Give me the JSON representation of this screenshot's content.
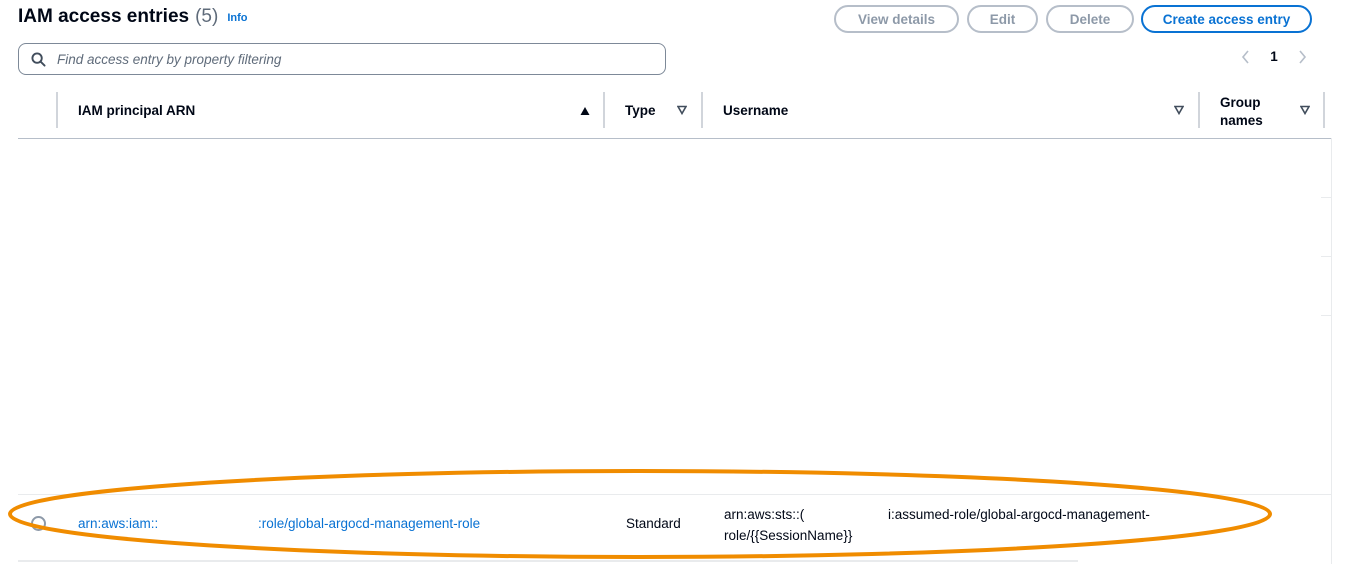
{
  "header": {
    "title": "IAM access entries",
    "count": "(5)",
    "info_label": "Info"
  },
  "actions": {
    "view_details": "View details",
    "edit": "Edit",
    "delete": "Delete",
    "create": "Create access entry"
  },
  "search": {
    "placeholder": "Find access entry by property filtering",
    "value": "",
    "icon": "search-icon"
  },
  "pagination": {
    "current_page": "1",
    "prev_icon": "chevron-left-icon",
    "next_icon": "chevron-right-icon"
  },
  "table": {
    "columns": [
      {
        "label": "IAM principal ARN",
        "sort": "ascending"
      },
      {
        "label": "Type",
        "sort": "none"
      },
      {
        "label": "Username",
        "sort": "none"
      },
      {
        "label": "Group names",
        "sort": "none"
      }
    ],
    "rows": [
      {
        "arn_prefix": "arn:aws:iam::",
        "arn_suffix": ":role/global-argocd-management-role",
        "type": "Standard",
        "username_line1_prefix": "arn:aws:sts::(",
        "username_line1_suffix": "i:assumed-role/global-argocd-management-",
        "username_line2": "role/{{SessionName}}",
        "selected": false
      }
    ]
  },
  "colors": {
    "accent": "#0972d3",
    "highlight": "#f08c00",
    "disabled": "#8d99a8"
  }
}
